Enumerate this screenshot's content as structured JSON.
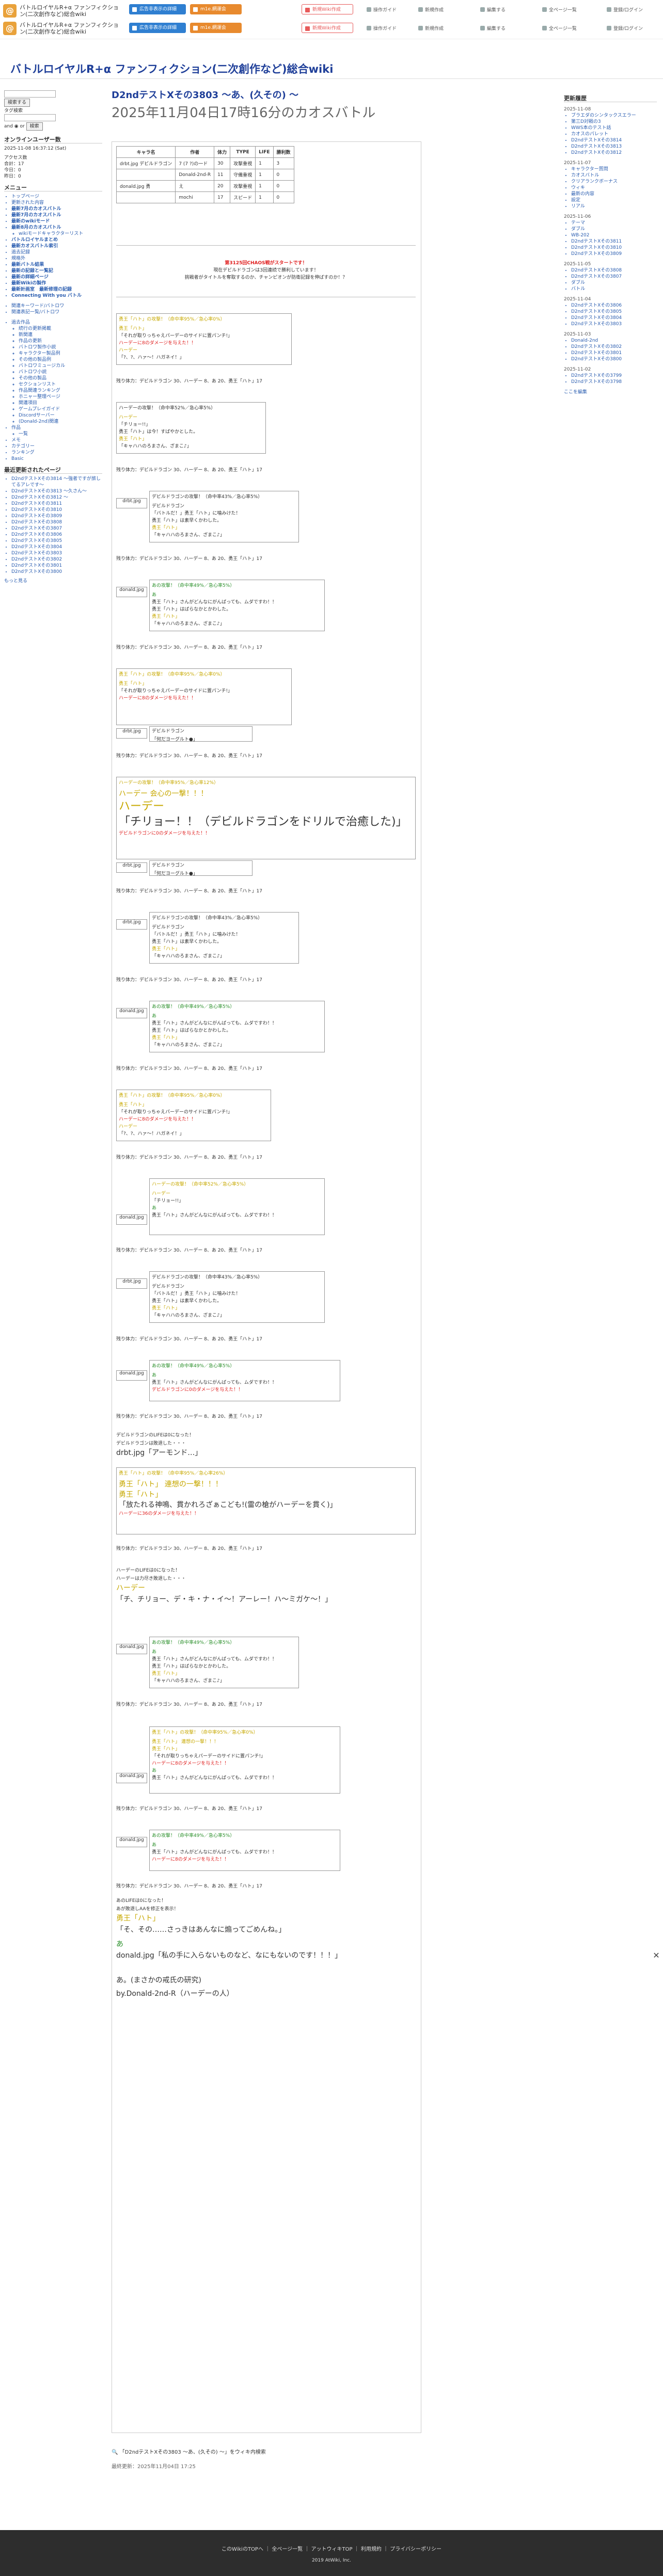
{
  "header": {
    "logo1": "バトルロイヤルR+α ファンフィクション(二次創作など)総合wiki",
    "logo2": "バトルロイヤルR+α ファンフィクション(二次創作など)総合wiki",
    "buttons": [
      {
        "label": "広告非表示の詳細"
      },
      {
        "label": "m1e.網運会"
      },
      {
        "label": "新規Wiki作成"
      },
      {
        "label": "広告非表示の詳細"
      },
      {
        "label": "m1e.網運会"
      },
      {
        "label": "新規Wiki作成"
      }
    ],
    "nav": [
      "操作ガイド",
      "新規作成",
      "編集する",
      "全ページ一覧",
      "登録/ログイン"
    ]
  },
  "site_title": "バトルロイヤルR+α ファンフィクション(二次創作など)総合wiki",
  "page": {
    "title": "D2ndテストXその3803 〜あ、(久その) 〜",
    "subtitle": "2025年11月04日17時16分のカオスバトル"
  },
  "left": {
    "search_placeholder": "",
    "search_btn": "検索する",
    "search_btn2": "検索",
    "tag_label": "タグ検索",
    "and_or": "and ◉ or",
    "online_label": "オンラインユーザー数",
    "online_time": "2025-11-08 16:37:12 (Sat)",
    "counter_title": "アクセス数",
    "counter": [
      "合計：17",
      "今日：0",
      "昨日：0"
    ],
    "menu_head": "メニュー",
    "menu": [
      {
        "t": "トップページ",
        "c": ""
      },
      {
        "t": "更新された内容",
        "c": ""
      },
      {
        "t": "最新7月のカオスバトル",
        "c": "b"
      },
      {
        "t": "最新7月のカオスバトル",
        "c": "b"
      },
      {
        "t": "最新のwikiモード",
        "c": "b"
      },
      {
        "t": "最新8月のカオスバトル",
        "c": "b"
      },
      {
        "t": "wikiモードキャラクターリスト",
        "c": "s"
      },
      {
        "t": "バトルロイヤルまとめ",
        "c": "b"
      },
      {
        "t": "最新カオスバトル索引",
        "c": "b"
      },
      {
        "t": "過去記録",
        "c": ""
      },
      {
        "t": "規格外",
        "c": ""
      },
      {
        "t": "最新バトル結果",
        "c": "b"
      },
      {
        "t": "最新の記録と一覧記",
        "c": "b"
      },
      {
        "t": "最新の詳細ページ",
        "c": "b"
      },
      {
        "t": "最新Wikiの製作",
        "c": "b"
      },
      {
        "t": "最新計画室　最新修理の記録",
        "c": "b"
      },
      {
        "t": "Connecting With you バトル",
        "c": "b"
      }
    ],
    "menu2": [
      {
        "t": "関連キーワード/バトロワ",
        "c": ""
      },
      {
        "t": "関連表記一覧/バトロワ",
        "c": ""
      }
    ],
    "menu3": [
      {
        "t": "過去作品",
        "c": ""
      },
      {
        "t": "続行の更新掲載",
        "c": "s"
      },
      {
        "t": "新関連",
        "c": "s"
      },
      {
        "t": "作品の更新",
        "c": "s"
      },
      {
        "t": "バトロワ製作小説",
        "c": "s"
      },
      {
        "t": "キャラクター製品例",
        "c": "s"
      },
      {
        "t": "その他の製品例",
        "c": "s"
      },
      {
        "t": "バトロワミュージカル",
        "c": "s"
      },
      {
        "t": "バトロワ小説",
        "c": "s"
      },
      {
        "t": "その他の製品",
        "c": "s"
      },
      {
        "t": "セクションリスト",
        "c": "s"
      },
      {
        "t": "作品関連ランキング",
        "c": "s"
      },
      {
        "t": "ホニャー整理ページ",
        "c": "s"
      },
      {
        "t": "関連項目",
        "c": "s"
      },
      {
        "t": "ゲームプレイガイド",
        "c": "s"
      },
      {
        "t": "Discordサーバー",
        "c": "s"
      },
      {
        "t": "(Donald-2nd)関連",
        "c": "s"
      },
      {
        "t": "作品",
        "c": ""
      },
      {
        "t": "一覧",
        "c": "s"
      },
      {
        "t": "メモ",
        "c": ""
      },
      {
        "t": "カテゴリー",
        "c": ""
      },
      {
        "t": "ランキング",
        "c": ""
      },
      {
        "t": "Basic",
        "c": ""
      }
    ],
    "recent_head": "最近更新されたページ",
    "recent": [
      "D2ndテストXその3814 〜強者ですが旅してるアレです〜",
      "D2ndテストXその3813 〜久さん〜",
      "D2ndテストXその3812 〜",
      "D2ndテストXその3811",
      "D2ndテストXその3810",
      "D2ndテストXその3809",
      "D2ndテストXその3808",
      "D2ndテストXその3807",
      "D2ndテストXその3806",
      "D2ndテストXその3805",
      "D2ndテストXその3804",
      "D2ndテストXその3803",
      "D2ndテストXその3802",
      "D2ndテストXその3801",
      "D2ndテストXその3800"
    ],
    "more": "もっと見る"
  },
  "right": {
    "head": "更新履歴",
    "groups": [
      {
        "date": "2025-11-08",
        "items": [
          "ブラエダのシンタックスエラー",
          "第三D対戦の3",
          "WWS本のテスト話",
          "カオスのパレット",
          "D2ndテストXその3814",
          "D2ndテストXその3813",
          "D2ndテストXその3812"
        ]
      },
      {
        "date": "2025-11-07",
        "items": [
          "キャラクター質問",
          "カオスバトル",
          "クリアランクボーナス",
          "ウィキ",
          "最新の内容",
          "設定",
          "リアル"
        ]
      },
      {
        "date": "2025-11-06",
        "items": [
          "テーマ",
          "ダブル",
          "WB-202",
          "D2ndテストXその3811",
          "D2ndテストXその3810",
          "D2ndテストXその3809"
        ]
      },
      {
        "date": "2025-11-05",
        "items": [
          "D2ndテストXその3808",
          "D2ndテストXその3807",
          "ダブル",
          "バトル"
        ]
      },
      {
        "date": "2025-11-04",
        "items": [
          "D2ndテストXその3806",
          "D2ndテストXその3805",
          "D2ndテストXその3804",
          "D2ndテストXその3803"
        ]
      },
      {
        "date": "2025-11-03",
        "items": [
          "Donald-2nd",
          "D2ndテストXその3802",
          "D2ndテストXその3801",
          "D2ndテストXその3800"
        ]
      },
      {
        "date": "2025-11-02",
        "items": [
          "D2ndテストXその3799",
          "D2ndテストXその3798"
        ]
      }
    ],
    "more": "ここを編集"
  },
  "stat_table": {
    "headers": [
      "キャラ名",
      "作者",
      "体力",
      "TYPE",
      "LIFE",
      "勝利数"
    ],
    "rows": [
      [
        "drbt.jpg デビルドラゴン",
        "7 (7 ?)の一ド",
        "30",
        "攻撃重視",
        "1",
        "3"
      ],
      [
        "",
        "Donald-2nd-R",
        "11",
        "守備重視",
        "1",
        "0"
      ],
      [
        "donald.jpg 勇",
        "え",
        "20",
        "攻撃重視",
        "1",
        "0"
      ],
      [
        "",
        "mochi",
        "17",
        "スピード",
        "1",
        "0"
      ]
    ]
  },
  "intro": {
    "l1": "第3125回CHAOS戦がスタートです！",
    "l2": "現在デビルドラゴンは3回連続で勝利しています！",
    "l3": "挑戦者がタイトルを奪取するのか、チャンピオンが防衛記録を伸ばすのか！？"
  },
  "battle": {
    "remaining": "残り体力：デビルドラゴン 30、ハーデー 8、あ 20、勇王「ハト」17",
    "hp_drgn": "デビルドラゴン",
    "atk1": "勇王「ハト」の攻撃！（命中率95%／急心率0%）",
    "atk1b": "勇王「ハト」",
    "atk1c": "「それが取りっちゃえパーデーのサイドに置パンチ!」",
    "atk1d": "ハーデーに8のダメージを与えた！！",
    "atk2": "ハーデー",
    "atk2b": "「?、?、ハァ〜！ハガネイ！」",
    "atk3": "ハーデーの攻撃！（命中率52%／急心率5%）",
    "atk3b": "ハーデー",
    "atk3c": "「チリョー!!」",
    "atk3d": "勇王「ハト」は今！すばやかとした。",
    "atk3e": "勇王「ハト」",
    "atk3f": "「キャハハのろまさん、ざまこ♪」",
    "dr_atk": "デビルドラゴンの攻撃！（命中率43%／急心率5%）",
    "dr_atk2": "デビルドラゴン",
    "dr_atk3": "「バトルだ！」勇王「ハト」に噛みけた！",
    "dr_atk4": "勇王「ハト」は素早くかわした。",
    "dr_atk5": "勇王「ハト」",
    "dr_atk6": "「キャハハのろまさん、ざまこ♪」",
    "ad_atk": "あの攻撃！（命中率49%／急心率5%）",
    "ad_atk2": "あ",
    "ad_atk3": "勇王「ハト」さんがどんなにがんばっても、ムダですわ！！",
    "ad_atk4": "勇王「ハト」はばらなかとかわした。",
    "ad_atk5": "勇王「ハト」",
    "ad_atk6": "「キャハハのろまさん、ざまこ♪」",
    "hd_big": "ハーデーの攻撃！（命中率95%／急心率12%）",
    "hd_big2": "ハーデー 会心の一撃！！！",
    "hd_big3": "ハーデー",
    "hd_big4": "「チリョー！！（デビルドラゴンをドリルで治癒した)」",
    "hd_big5": "デビルドラゴンに0のダメージを与えた！！",
    "hd_big6": "デビルドラゴン",
    "hd_big7": "「何だヨーグルト●」",
    "drbt": "drbt.jpg",
    "donald": "donald.jpg",
    "end1": "デビルドラゴンのLIFEは0になった！",
    "end2": "デビルドラゴンは敗退した・・・",
    "end3": "drbt.jpg「アーモンド…」",
    "hato_big": "勇王「ハト」の攻撃！（命中率95%／急心率26%）",
    "hato_big2": "勇王「ハト」 連想の一撃！！！",
    "hato_big3": "勇王「ハト」",
    "hato_big4": "「放たれる神鳴、貫かれろざぁこども!(雷の槍がハーデーを貫く)」",
    "hato_big5": "ハーデーに36のダメージを与えた！！",
    "hd_end1": "ハーデーのLIFEは0になった！",
    "hd_end2": "ハーデーは力尽き敗退した・・・",
    "hd_end3": "ハーデー",
    "hd_end4": "「チ、チリョー、デ・キ・ナ・イ〜！アーレー！ハ〜ミガケ〜！」",
    "last1": "あのLIFEは0になった！",
    "last2": "あが敗退しAAを修正を表示！",
    "last3": "勇王「ハト」",
    "last4": "「そ、その……さっきはあんなに煽ってごめんね。」",
    "last5": "あ",
    "last6": "donald.jpg「私の手に入らないものなど、なにもないのです！！！」",
    "last7": "あ。(まさかの戒氏の研究)",
    "last8": "by.Donald-2nd-R（ハーデーの人）"
  },
  "bottom": {
    "link": "「D2ndテストXその3803 〜あ、(久その) 〜」をウィキ内検索",
    "updated": "最終更新：2025年11月04日 17:25"
  },
  "footer": {
    "links": [
      "このWikiのTOPへ",
      "全ページ一覧",
      "アットウィキTOP",
      "利用規約",
      "プライバシーポリシー"
    ],
    "copy": "2019 AtWiki, Inc."
  },
  "icons": {
    "close": "close-icon"
  }
}
